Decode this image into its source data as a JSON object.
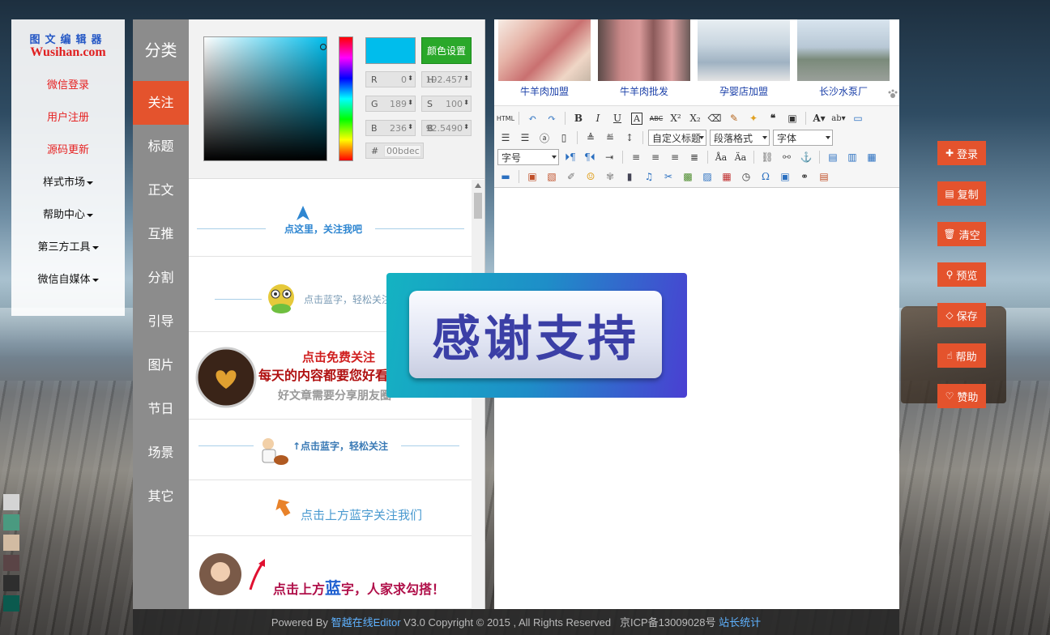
{
  "leftnav": {
    "logo_top": "图文编辑器",
    "logo_bottom": "Wusihan.com",
    "items": [
      {
        "label": "微信登录"
      },
      {
        "label": "用户注册"
      },
      {
        "label": "源码更新"
      },
      {
        "label": "样式市场"
      },
      {
        "label": "帮助中心"
      },
      {
        "label": "第三方工具"
      },
      {
        "label": "微信自媒体"
      }
    ]
  },
  "categories": {
    "heading": "分类",
    "items": [
      "关注",
      "标题",
      "正文",
      "互推",
      "分割",
      "引导",
      "图片",
      "节日",
      "场景",
      "其它"
    ],
    "active": "关注"
  },
  "colorpicker": {
    "color": "#00bdec",
    "button": "颜色设置",
    "fields": {
      "R": {
        "label": "R",
        "value": "0"
      },
      "G": {
        "label": "G",
        "value": "189"
      },
      "B": {
        "label": "B",
        "value": "236"
      },
      "H": {
        "label": "H",
        "value": "192.457"
      },
      "S": {
        "label": "S",
        "value": "100"
      },
      "Bv": {
        "label": "B",
        "value": "92.5490"
      }
    },
    "hex_label": "#",
    "hex_value": "00bdec"
  },
  "styles": {
    "s1": {
      "text": "点这里，关注我吧"
    },
    "s2": {
      "text": "点击蓝字，轻松关注"
    },
    "s3": {
      "line1": "点击免费关注",
      "line2": "每天的内容都要您好看",
      "line3": "好文章需要分享朋友圈"
    },
    "s4": {
      "text": "↑点击蓝字，轻松关注"
    },
    "s5": {
      "text": "点击上方蓝字关注我们"
    },
    "s6": {
      "pre": "点击上方",
      "blue": "蓝",
      "mid": "字",
      "post": "，人家求勾搭！"
    }
  },
  "ads": [
    {
      "caption": "牛羊肉加盟"
    },
    {
      "caption": "牛羊肉批发"
    },
    {
      "caption": "孕婴店加盟"
    },
    {
      "caption": "长沙水泵厂"
    }
  ],
  "toolbar": {
    "html_label": "HTML",
    "custom_heading": "自定义标题",
    "paragraph": "段落格式",
    "font": "字体",
    "fontsize": "字号",
    "omega": "Ω"
  },
  "overlay": {
    "text": "感谢支持"
  },
  "right_buttons": [
    {
      "label": "登录",
      "icon": "plus-icon"
    },
    {
      "label": "复制",
      "icon": "document-icon"
    },
    {
      "label": "清空",
      "icon": "trash-icon"
    },
    {
      "label": "预览",
      "icon": "search-icon"
    },
    {
      "label": "保存",
      "icon": "save-icon"
    },
    {
      "label": "帮助",
      "icon": "hand-icon"
    },
    {
      "label": "赞助",
      "icon": "heart-icon"
    }
  ],
  "theme_colors": [
    "#d4d4d4",
    "#4a9a80",
    "#d2bba2",
    "#5a4446",
    "#2e2e2e",
    "#0b5a4e"
  ],
  "footer": {
    "prefix": "Powered By",
    "brand": "智越在线Editor",
    "rest": "V3.0 Copyright © 2015 , All Rights Reserved",
    "icp": "京ICP备13009028号",
    "stats": "站长统计"
  }
}
